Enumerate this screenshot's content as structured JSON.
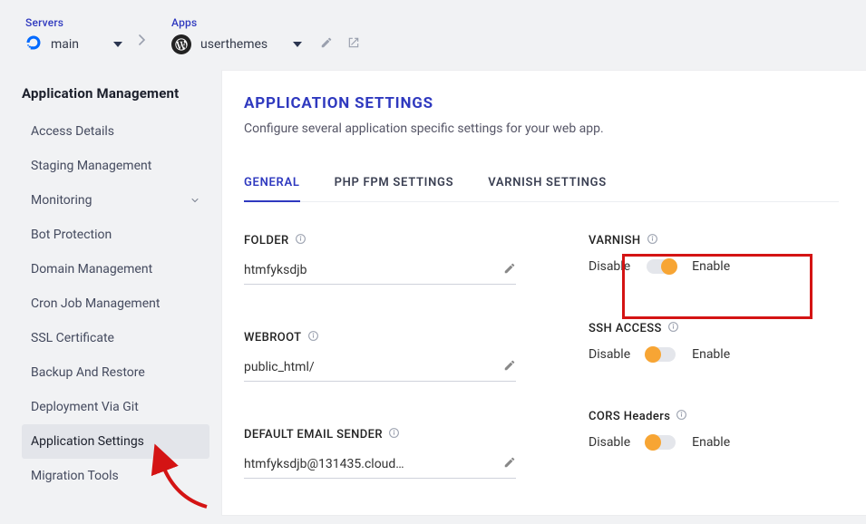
{
  "breadcrumb": {
    "servers_label": "Servers",
    "server_name": "main",
    "apps_label": "Apps",
    "app_name": "userthemes"
  },
  "sidebar": {
    "heading": "Application Management",
    "items": [
      {
        "label": "Access Details"
      },
      {
        "label": "Staging Management"
      },
      {
        "label": "Monitoring",
        "has_chevron": true
      },
      {
        "label": "Bot Protection"
      },
      {
        "label": "Domain Management"
      },
      {
        "label": "Cron Job Management"
      },
      {
        "label": "SSL Certificate"
      },
      {
        "label": "Backup And Restore"
      },
      {
        "label": "Deployment Via Git"
      },
      {
        "label": "Application Settings",
        "active": true
      },
      {
        "label": "Migration Tools"
      }
    ]
  },
  "page": {
    "title": "APPLICATION SETTINGS",
    "desc": "Configure several application specific settings for your web app."
  },
  "tabs": [
    {
      "label": "GENERAL",
      "active": true
    },
    {
      "label": "PHP FPM SETTINGS"
    },
    {
      "label": "VARNISH SETTINGS"
    }
  ],
  "fields": {
    "folder": {
      "label": "FOLDER",
      "value": "htmfyksdjb"
    },
    "webroot": {
      "label": "WEBROOT",
      "value": "public_html/"
    },
    "email": {
      "label": "DEFAULT EMAIL SENDER",
      "value": "htmfyksdjb@131435.cloud…"
    }
  },
  "toggles": {
    "varnish": {
      "label": "VARNISH",
      "disable": "Disable",
      "enable": "Enable",
      "state": "on"
    },
    "ssh": {
      "label": "SSH ACCESS",
      "disable": "Disable",
      "enable": "Enable",
      "state": "off"
    },
    "cors": {
      "label": "CORS Headers",
      "disable": "Disable",
      "enable": "Enable",
      "state": "off"
    }
  }
}
